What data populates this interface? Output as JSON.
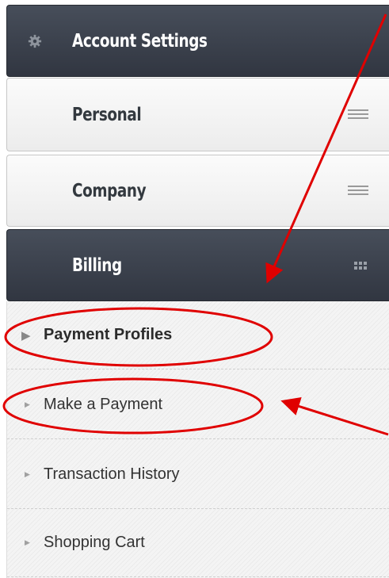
{
  "menu": {
    "header": {
      "label": "Account Settings",
      "icon": "gear-icon"
    },
    "sections": [
      {
        "label": "Personal",
        "icon": "menu-lines-icon"
      },
      {
        "label": "Company",
        "icon": "menu-lines-icon"
      },
      {
        "label": "Billing",
        "icon": "grid-dots-icon"
      }
    ],
    "billing_items": [
      {
        "label": "Payment Profiles",
        "active": true
      },
      {
        "label": "Make a Payment",
        "active": false
      },
      {
        "label": "Transaction History",
        "active": false
      },
      {
        "label": "Shopping Cart",
        "active": false
      }
    ]
  },
  "annotation_color": "#e00000",
  "colors": {
    "dark_header": "#3b414c",
    "light_header": "#f2f2f2"
  }
}
